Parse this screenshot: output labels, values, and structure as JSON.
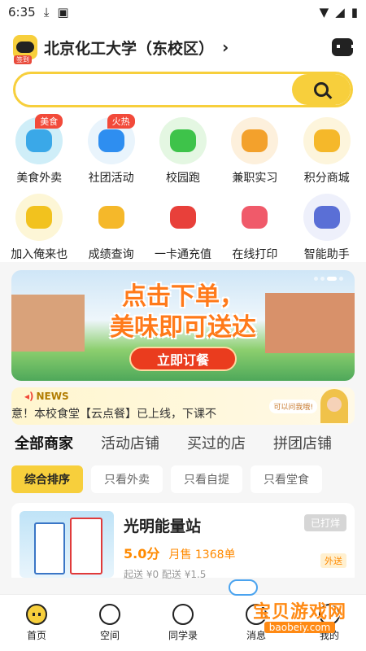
{
  "status_bar": {
    "time": "6:35"
  },
  "header": {
    "campus_name": "北京化工大学（东校区）",
    "avatar_tag": "签到"
  },
  "search": {
    "placeholder": ""
  },
  "quick_grid": [
    {
      "label": "美食外卖",
      "badge": "美食",
      "icon": "food-delivery-icon",
      "bg": "#cfeef8",
      "fg": "#3aa8e8"
    },
    {
      "label": "社团活动",
      "badge": "火热",
      "icon": "club-activity-icon",
      "bg": "#e9f4fc",
      "fg": "#2e8ef0"
    },
    {
      "label": "校园跑",
      "badge": "",
      "icon": "campus-run-icon",
      "bg": "#e4f7e2",
      "fg": "#3ec34a"
    },
    {
      "label": "兼职实习",
      "badge": "",
      "icon": "part-time-job-icon",
      "bg": "#fdf0dc",
      "fg": "#f3a12c"
    },
    {
      "label": "积分商城",
      "badge": "",
      "icon": "points-mall-icon",
      "bg": "#fdf5dc",
      "fg": "#f5b82a"
    },
    {
      "label": "加入俺来也",
      "badge": "",
      "icon": "join-us-icon",
      "bg": "#fdf6d6",
      "fg": "#f2c21e"
    },
    {
      "label": "成绩查询",
      "badge": "",
      "icon": "grade-query-icon",
      "bg": "#ffffff",
      "fg": "#f5b82a"
    },
    {
      "label": "一卡通充值",
      "badge": "",
      "icon": "card-recharge-icon",
      "bg": "#ffffff",
      "fg": "#e8403a"
    },
    {
      "label": "在线打印",
      "badge": "",
      "icon": "online-print-icon",
      "bg": "#ffffff",
      "fg": "#f05a6a"
    },
    {
      "label": "智能助手",
      "badge": "",
      "icon": "smart-assistant-icon",
      "bg": "#eef0fb",
      "fg": "#5a6fd6"
    }
  ],
  "banner": {
    "title_line1": "点击下单，",
    "title_line2": "美味即可送达",
    "cta": "立即订餐"
  },
  "news": {
    "tag": "NEWS",
    "text": "意！本校食堂【云点餐】已上线，下课不",
    "bubble": "可以问我哦!"
  },
  "tabs": [
    "全部商家",
    "活动店铺",
    "买过的店",
    "拼团店铺"
  ],
  "filters": [
    "综合排序",
    "只看外卖",
    "只看自提",
    "只看堂食"
  ],
  "shop": {
    "name": "光明能量站",
    "score": "5.0分",
    "sales": "月售 1368单",
    "fee": "起送 ¥0 配送 ¥1.5",
    "status": "已打烊",
    "tag": "外送"
  },
  "bottom_nav": [
    "首页",
    "空间",
    "同学录",
    "消息",
    "我的"
  ],
  "watermark": {
    "text": "宝贝游戏网",
    "url": "baobeiy.com"
  }
}
